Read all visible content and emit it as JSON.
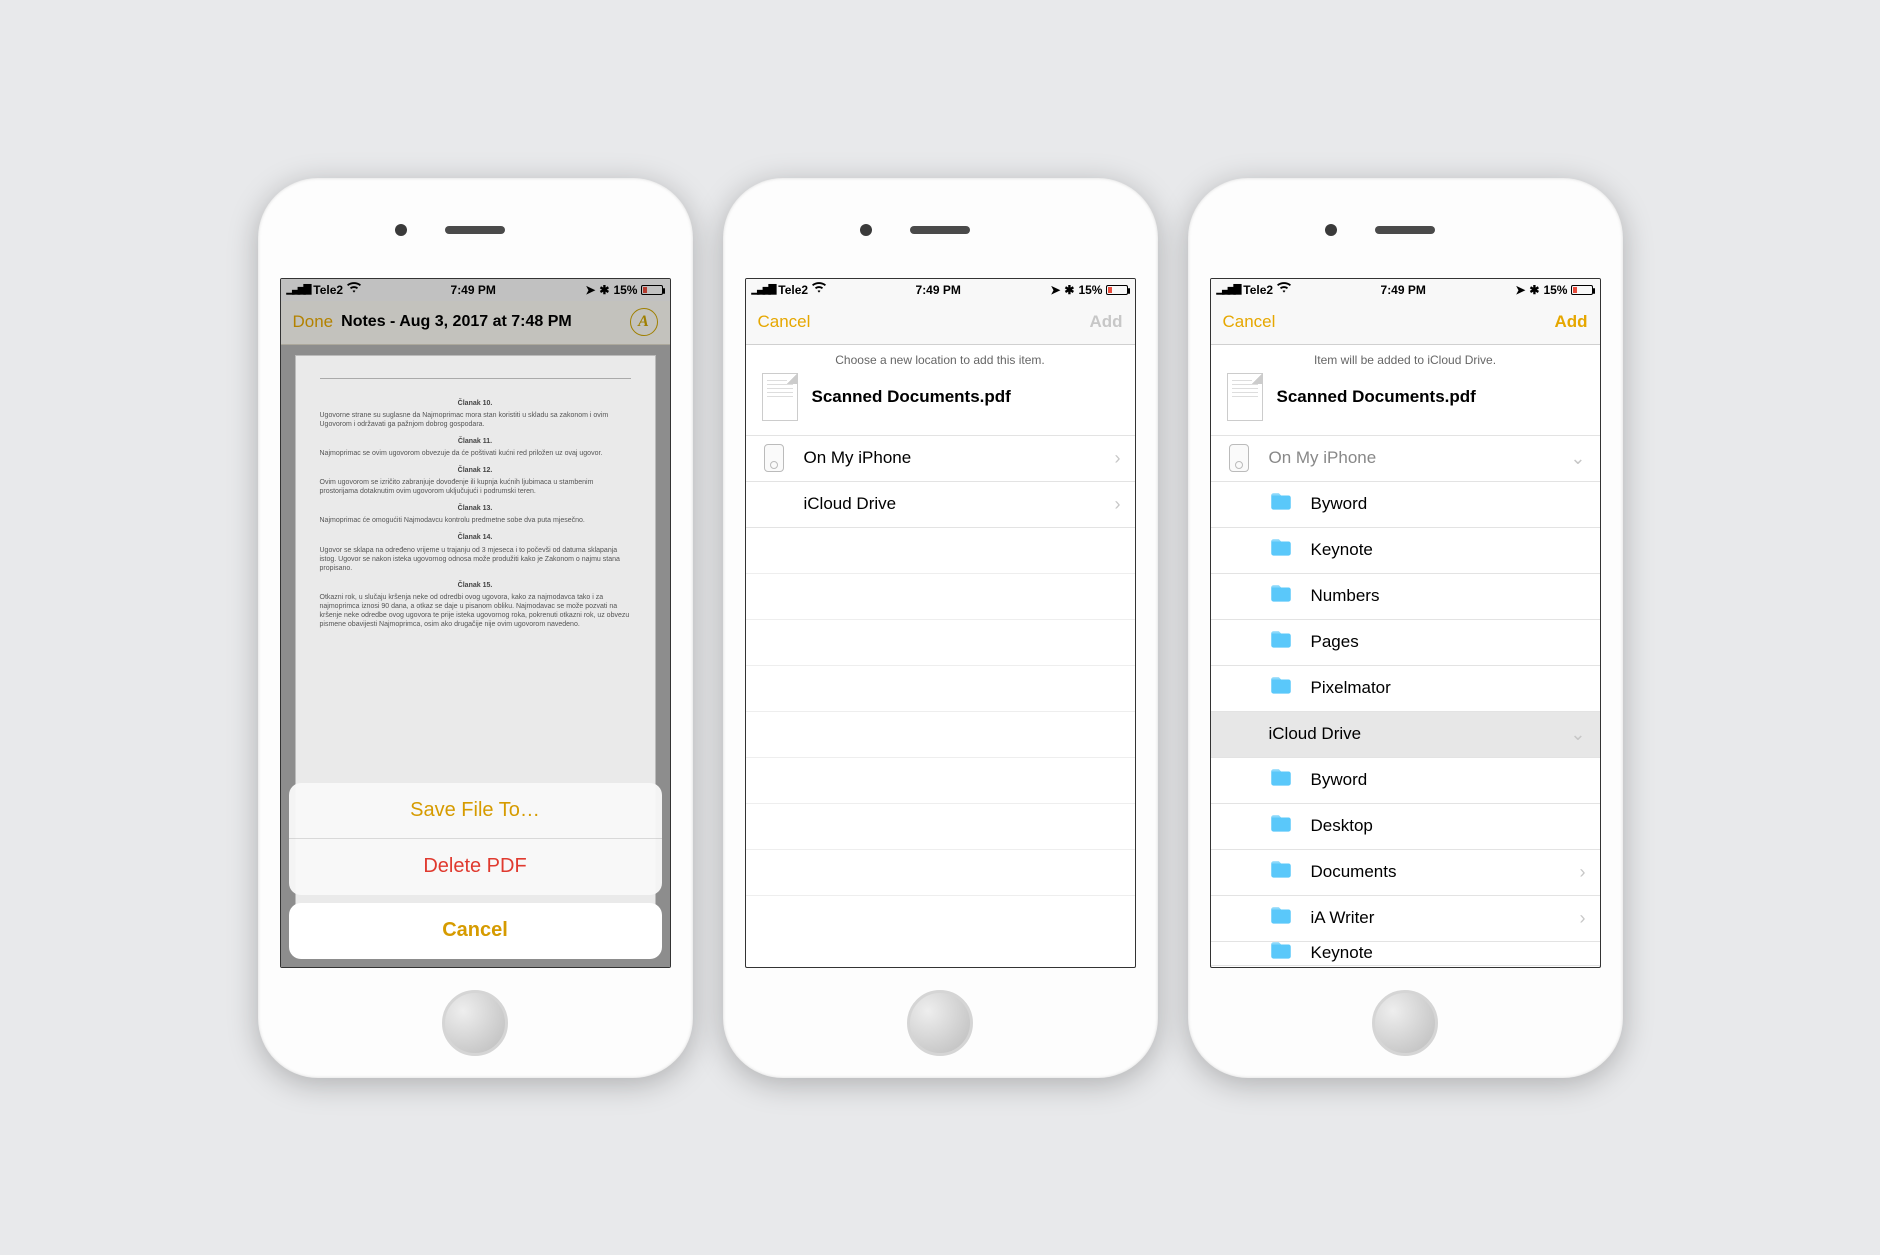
{
  "status": {
    "carrier": "Tele2",
    "time": "7:49 PM",
    "battery_pct": "15%"
  },
  "colors": {
    "accent": "#e6a700",
    "destructive": "#e03a2f",
    "folder": "#5ac8fa"
  },
  "phone1": {
    "nav_done": "Done",
    "nav_title": "Notes - Aug 3, 2017 at 7:48 PM",
    "markup_glyph": "A",
    "doc_articles": [
      {
        "h": "Članak 10.",
        "t": "Ugovorne strane su suglasne da Najmoprimac mora stan koristiti u skladu sa zakonom i ovim Ugovorom i održavati ga pažnjom dobrog gospodara."
      },
      {
        "h": "Članak 11.",
        "t": "Najmoprimac se ovim ugovorom obvezuje da će poštivati kućni red priložen uz ovaj ugovor."
      },
      {
        "h": "Članak 12.",
        "t": "Ovim ugovorom se izričito zabranjuje dovođenje ili kupnja kućnih ljubimaca u stambenim prostorijama dotaknutim ovim ugovorom uključujući i podrumski teren."
      },
      {
        "h": "Članak 13.",
        "t": "Najmoprimac će omogućiti Najmodavcu kontrolu predmetne sobe dva puta mjesečno."
      },
      {
        "h": "Članak 14.",
        "t": "Ugovor se sklapa na određeno vrijeme u trajanju od 3 mjeseca i to počevši od datuma sklapanja istog. Ugovor se nakon isteka ugovornog odnosa može produžiti kako je Zakonom o najmu stana propisano."
      },
      {
        "h": "Članak 15.",
        "t": "Otkazni rok, u slučaju kršenja neke od odredbi ovog ugovora, kako za najmodavca tako i za najmoprimca iznosi 90 dana, a otkaz se daje u pisanom obliku. Najmodavac se može pozvati na kršenje neke odredbe ovog ugovora te prije isteka ugovornog roka, pokrenuti otkazni rok, uz obvezu pismene obavijesti Najmoprimca, osim ako drugačije nije ovim ugovorom navedeno."
      }
    ],
    "sheet": {
      "save": "Save File To…",
      "delete": "Delete PDF",
      "cancel": "Cancel"
    }
  },
  "phone2": {
    "nav_cancel": "Cancel",
    "nav_add": "Add",
    "subtitle": "Choose a new location to add this item.",
    "filename": "Scanned Documents.pdf",
    "locations": [
      {
        "icon": "device",
        "label": "On My iPhone",
        "chevron": "right"
      },
      {
        "icon": "cloud",
        "label": "iCloud Drive",
        "chevron": "right"
      }
    ]
  },
  "phone3": {
    "nav_cancel": "Cancel",
    "nav_add": "Add",
    "subtitle": "Item will be added to iCloud Drive.",
    "filename": "Scanned Documents.pdf",
    "rows": [
      {
        "type": "section",
        "icon": "device",
        "label": "On My iPhone",
        "chevron": "down",
        "dim": true
      },
      {
        "type": "folder",
        "label": "Byword"
      },
      {
        "type": "folder",
        "label": "Keynote"
      },
      {
        "type": "folder",
        "label": "Numbers"
      },
      {
        "type": "folder",
        "label": "Pages"
      },
      {
        "type": "folder",
        "label": "Pixelmator"
      },
      {
        "type": "section",
        "icon": "cloud",
        "label": "iCloud Drive",
        "chevron": "down",
        "selected": true
      },
      {
        "type": "folder",
        "label": "Byword"
      },
      {
        "type": "folder",
        "label": "Desktop"
      },
      {
        "type": "folder",
        "label": "Documents",
        "chevron": "right"
      },
      {
        "type": "folder",
        "label": "iA Writer",
        "chevron": "right"
      },
      {
        "type": "folder",
        "label": "Keynote",
        "partial": true
      }
    ]
  }
}
